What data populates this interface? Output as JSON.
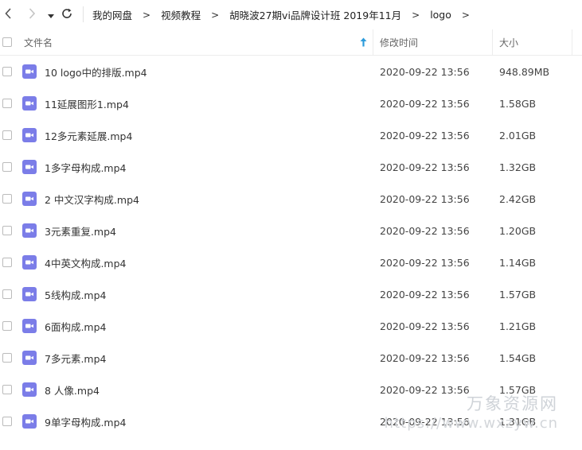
{
  "breadcrumbs": [
    "我的网盘",
    "视频教程",
    "胡晓波27期vi品牌设计班 2019年11月",
    "logo"
  ],
  "columns": {
    "name": "文件名",
    "modified": "修改时间",
    "size": "大小"
  },
  "colors": {
    "video_icon": "#7b7de8",
    "sort_arrow": "#2d9cdb"
  },
  "files": [
    {
      "name": "10 logo中的排版.mp4",
      "modified": "2020-09-22 13:56",
      "size": "948.89MB"
    },
    {
      "name": "11延展图形1.mp4",
      "modified": "2020-09-22 13:56",
      "size": "1.58GB"
    },
    {
      "name": "12多元素延展.mp4",
      "modified": "2020-09-22 13:56",
      "size": "2.01GB"
    },
    {
      "name": "1多字母构成.mp4",
      "modified": "2020-09-22 13:56",
      "size": "1.32GB"
    },
    {
      "name": "2 中文汉字构成.mp4",
      "modified": "2020-09-22 13:56",
      "size": "2.42GB"
    },
    {
      "name": "3元素重复.mp4",
      "modified": "2020-09-22 13:56",
      "size": "1.20GB"
    },
    {
      "name": "4中英文构成.mp4",
      "modified": "2020-09-22 13:56",
      "size": "1.14GB"
    },
    {
      "name": "5线构成.mp4",
      "modified": "2020-09-22 13:56",
      "size": "1.57GB"
    },
    {
      "name": "6面构成.mp4",
      "modified": "2020-09-22 13:56",
      "size": "1.21GB"
    },
    {
      "name": "7多元素.mp4",
      "modified": "2020-09-22 13:56",
      "size": "1.54GB"
    },
    {
      "name": "8 人像.mp4",
      "modified": "2020-09-22 13:56",
      "size": "1.57GB"
    },
    {
      "name": "9单字母构成.mp4",
      "modified": "2020-09-22 13:56",
      "size": "1.31GB"
    }
  ],
  "watermark": {
    "line1": "万象资源网",
    "line2": "https://www.wxzyw.cn"
  }
}
